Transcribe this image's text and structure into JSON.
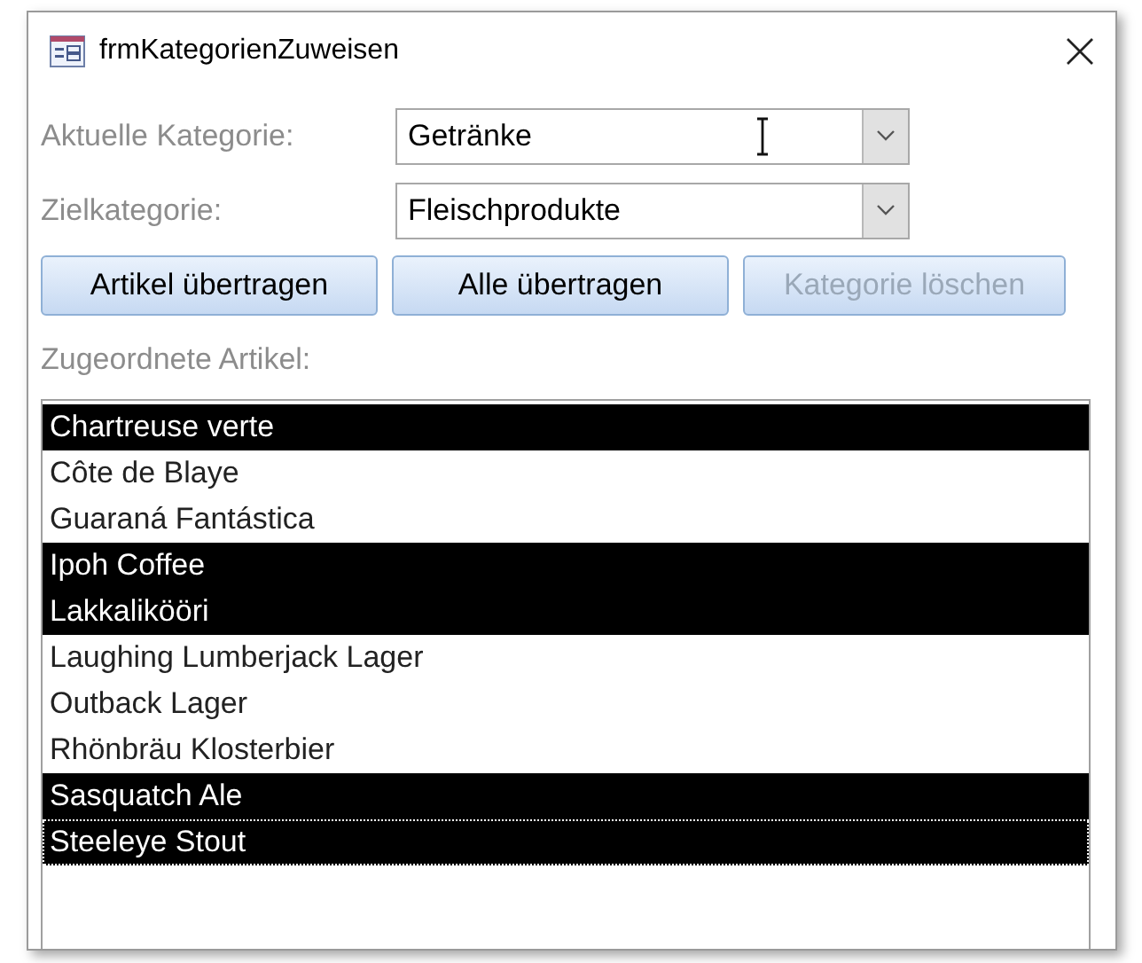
{
  "window": {
    "title": "frmKategorienZuweisen"
  },
  "fields": [
    {
      "label": "Aktuelle Kategorie:",
      "value": "Getränke",
      "cursor": true
    },
    {
      "label": "Zielkategorie:",
      "value": "Fleischprodukte",
      "cursor": false
    }
  ],
  "buttons": [
    {
      "label": "Artikel übertragen",
      "disabled": false
    },
    {
      "label": "Alle übertragen",
      "disabled": false
    },
    {
      "label": "Kategorie löschen",
      "disabled": true
    }
  ],
  "list": {
    "label": "Zugeordnete Artikel:",
    "items": [
      {
        "text": "Chartreuse verte",
        "selected": true,
        "focused": false
      },
      {
        "text": "Côte de Blaye",
        "selected": false,
        "focused": false
      },
      {
        "text": "Guaraná Fantástica",
        "selected": false,
        "focused": false
      },
      {
        "text": "Ipoh Coffee",
        "selected": true,
        "focused": false
      },
      {
        "text": "Lakkalikööri",
        "selected": true,
        "focused": false
      },
      {
        "text": "Laughing Lumberjack Lager",
        "selected": false,
        "focused": false
      },
      {
        "text": "Outback Lager",
        "selected": false,
        "focused": false
      },
      {
        "text": "Rhönbräu Klosterbier",
        "selected": false,
        "focused": false
      },
      {
        "text": "Sasquatch Ale",
        "selected": true,
        "focused": false
      },
      {
        "text": "Steeleye Stout",
        "selected": true,
        "focused": true
      }
    ]
  }
}
